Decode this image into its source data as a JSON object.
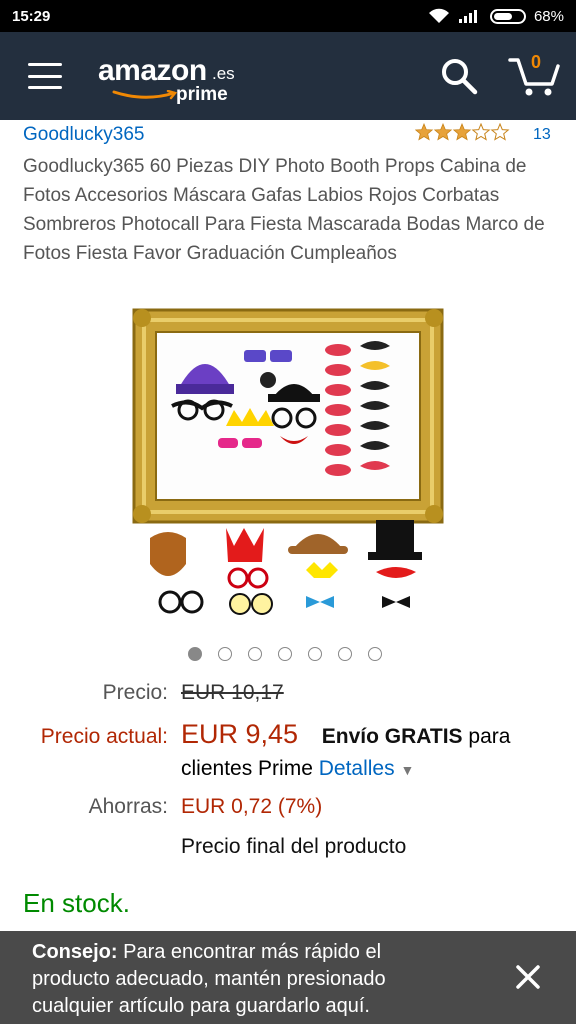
{
  "status_bar": {
    "time": "15:29",
    "battery": "68%",
    "icons": [
      "wifi-icon",
      "signal-icon",
      "battery-icon"
    ]
  },
  "header": {
    "logo_text": "amazon",
    "logo_suffix": ".es",
    "logo_prime": "prime",
    "cart_count": "0",
    "icons": [
      "menu-icon",
      "search-icon",
      "cart-icon"
    ],
    "colors": {
      "header_bg": "#232f3e",
      "accent": "#f08804"
    }
  },
  "product": {
    "brand": "Goodlucky365",
    "rating": {
      "stars": 3,
      "max": 5,
      "count": "13"
    },
    "title": "Goodlucky365 60 Piezas DIY Photo Booth Props Cabina de Fotos Accesorios Máscara Gafas Labios Rojos Corbatas Sombreros Photocall Para Fiesta Mascarada Bodas Marco de Fotos Fiesta Favor Graduación Cumpleaños",
    "image_icon": "product-photo-props-image",
    "carousel": {
      "total": 7,
      "active": 1
    }
  },
  "price": {
    "list_label": "Precio:",
    "list_value": "EUR 10,17",
    "current_label": "Precio actual:",
    "current_value": "EUR 9,45",
    "shipping_bold": "Envío GRATIS",
    "shipping_rest": "para",
    "shipping_line2": "clientes Prime",
    "details_link": "Detalles",
    "savings_label": "Ahorras:",
    "savings_value": "EUR 0,72 (7%)",
    "final_note": "Precio final del producto",
    "colors": {
      "price_red": "#b12704",
      "link_blue": "#0066c0"
    }
  },
  "stock": {
    "text": "En stock.",
    "color": "#008a00"
  },
  "toast": {
    "lead": "Consejo:",
    "text": "Para encontrar más rápido el producto adecuado, mantén presionado cualquier artículo para guardarlo aquí."
  }
}
